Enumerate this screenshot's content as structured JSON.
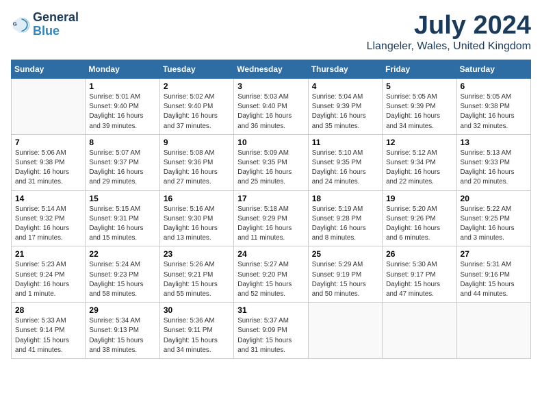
{
  "header": {
    "logo_general": "General",
    "logo_blue": "Blue",
    "month_year": "July 2024",
    "location": "Llangeler, Wales, United Kingdom"
  },
  "days_of_week": [
    "Sunday",
    "Monday",
    "Tuesday",
    "Wednesday",
    "Thursday",
    "Friday",
    "Saturday"
  ],
  "weeks": [
    [
      {
        "day": "",
        "info": ""
      },
      {
        "day": "1",
        "info": "Sunrise: 5:01 AM\nSunset: 9:40 PM\nDaylight: 16 hours\nand 39 minutes."
      },
      {
        "day": "2",
        "info": "Sunrise: 5:02 AM\nSunset: 9:40 PM\nDaylight: 16 hours\nand 37 minutes."
      },
      {
        "day": "3",
        "info": "Sunrise: 5:03 AM\nSunset: 9:40 PM\nDaylight: 16 hours\nand 36 minutes."
      },
      {
        "day": "4",
        "info": "Sunrise: 5:04 AM\nSunset: 9:39 PM\nDaylight: 16 hours\nand 35 minutes."
      },
      {
        "day": "5",
        "info": "Sunrise: 5:05 AM\nSunset: 9:39 PM\nDaylight: 16 hours\nand 34 minutes."
      },
      {
        "day": "6",
        "info": "Sunrise: 5:05 AM\nSunset: 9:38 PM\nDaylight: 16 hours\nand 32 minutes."
      }
    ],
    [
      {
        "day": "7",
        "info": "Sunrise: 5:06 AM\nSunset: 9:38 PM\nDaylight: 16 hours\nand 31 minutes."
      },
      {
        "day": "8",
        "info": "Sunrise: 5:07 AM\nSunset: 9:37 PM\nDaylight: 16 hours\nand 29 minutes."
      },
      {
        "day": "9",
        "info": "Sunrise: 5:08 AM\nSunset: 9:36 PM\nDaylight: 16 hours\nand 27 minutes."
      },
      {
        "day": "10",
        "info": "Sunrise: 5:09 AM\nSunset: 9:35 PM\nDaylight: 16 hours\nand 25 minutes."
      },
      {
        "day": "11",
        "info": "Sunrise: 5:10 AM\nSunset: 9:35 PM\nDaylight: 16 hours\nand 24 minutes."
      },
      {
        "day": "12",
        "info": "Sunrise: 5:12 AM\nSunset: 9:34 PM\nDaylight: 16 hours\nand 22 minutes."
      },
      {
        "day": "13",
        "info": "Sunrise: 5:13 AM\nSunset: 9:33 PM\nDaylight: 16 hours\nand 20 minutes."
      }
    ],
    [
      {
        "day": "14",
        "info": "Sunrise: 5:14 AM\nSunset: 9:32 PM\nDaylight: 16 hours\nand 17 minutes."
      },
      {
        "day": "15",
        "info": "Sunrise: 5:15 AM\nSunset: 9:31 PM\nDaylight: 16 hours\nand 15 minutes."
      },
      {
        "day": "16",
        "info": "Sunrise: 5:16 AM\nSunset: 9:30 PM\nDaylight: 16 hours\nand 13 minutes."
      },
      {
        "day": "17",
        "info": "Sunrise: 5:18 AM\nSunset: 9:29 PM\nDaylight: 16 hours\nand 11 minutes."
      },
      {
        "day": "18",
        "info": "Sunrise: 5:19 AM\nSunset: 9:28 PM\nDaylight: 16 hours\nand 8 minutes."
      },
      {
        "day": "19",
        "info": "Sunrise: 5:20 AM\nSunset: 9:26 PM\nDaylight: 16 hours\nand 6 minutes."
      },
      {
        "day": "20",
        "info": "Sunrise: 5:22 AM\nSunset: 9:25 PM\nDaylight: 16 hours\nand 3 minutes."
      }
    ],
    [
      {
        "day": "21",
        "info": "Sunrise: 5:23 AM\nSunset: 9:24 PM\nDaylight: 16 hours\nand 1 minute."
      },
      {
        "day": "22",
        "info": "Sunrise: 5:24 AM\nSunset: 9:23 PM\nDaylight: 15 hours\nand 58 minutes."
      },
      {
        "day": "23",
        "info": "Sunrise: 5:26 AM\nSunset: 9:21 PM\nDaylight: 15 hours\nand 55 minutes."
      },
      {
        "day": "24",
        "info": "Sunrise: 5:27 AM\nSunset: 9:20 PM\nDaylight: 15 hours\nand 52 minutes."
      },
      {
        "day": "25",
        "info": "Sunrise: 5:29 AM\nSunset: 9:19 PM\nDaylight: 15 hours\nand 50 minutes."
      },
      {
        "day": "26",
        "info": "Sunrise: 5:30 AM\nSunset: 9:17 PM\nDaylight: 15 hours\nand 47 minutes."
      },
      {
        "day": "27",
        "info": "Sunrise: 5:31 AM\nSunset: 9:16 PM\nDaylight: 15 hours\nand 44 minutes."
      }
    ],
    [
      {
        "day": "28",
        "info": "Sunrise: 5:33 AM\nSunset: 9:14 PM\nDaylight: 15 hours\nand 41 minutes."
      },
      {
        "day": "29",
        "info": "Sunrise: 5:34 AM\nSunset: 9:13 PM\nDaylight: 15 hours\nand 38 minutes."
      },
      {
        "day": "30",
        "info": "Sunrise: 5:36 AM\nSunset: 9:11 PM\nDaylight: 15 hours\nand 34 minutes."
      },
      {
        "day": "31",
        "info": "Sunrise: 5:37 AM\nSunset: 9:09 PM\nDaylight: 15 hours\nand 31 minutes."
      },
      {
        "day": "",
        "info": ""
      },
      {
        "day": "",
        "info": ""
      },
      {
        "day": "",
        "info": ""
      }
    ]
  ]
}
